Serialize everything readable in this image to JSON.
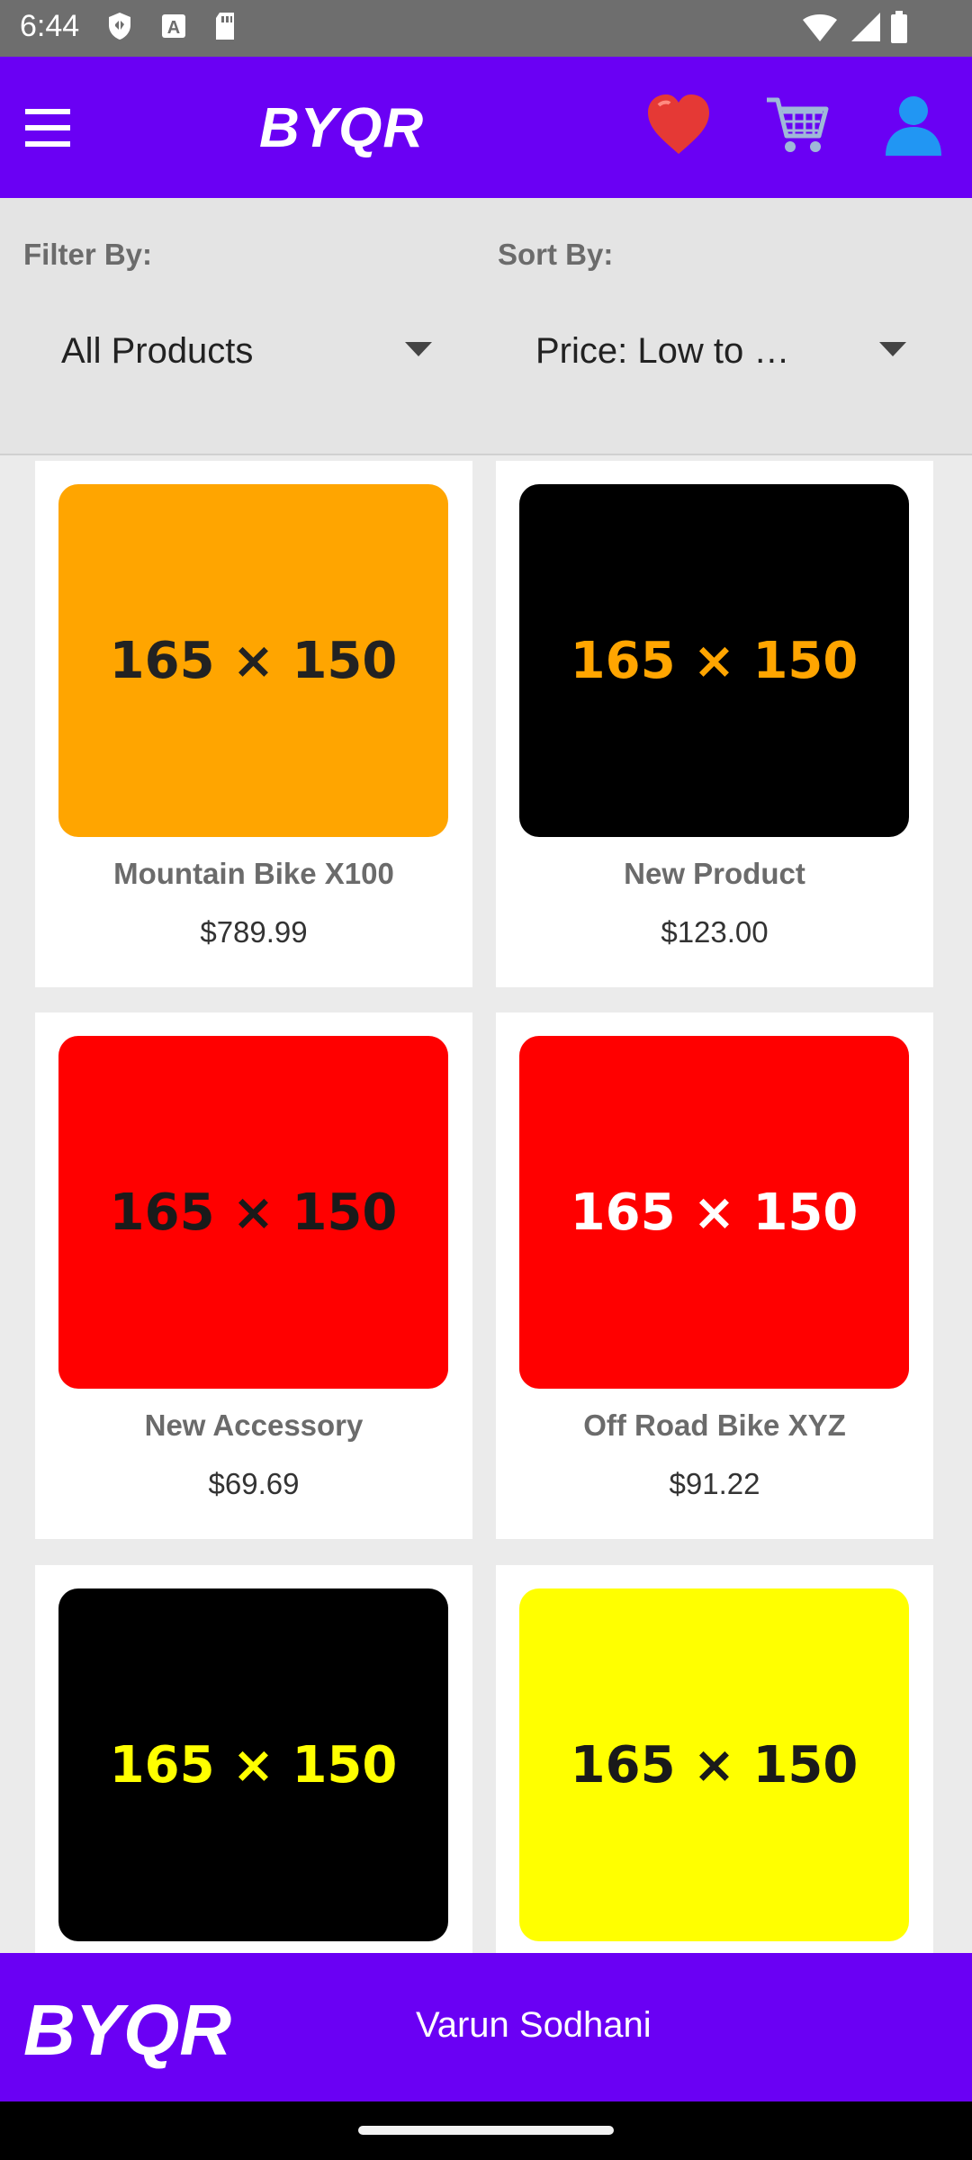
{
  "status": {
    "time": "6:44"
  },
  "appbar": {
    "brand": "BYQR"
  },
  "controls": {
    "filter_label": "Filter By:",
    "filter_value": "All Products",
    "sort_label": "Sort By:",
    "sort_value": "Price: Low to …"
  },
  "products": [
    {
      "name": "Mountain Bike X100",
      "price": "$789.99",
      "thumb_text": "165 × 150",
      "bg": "#ffa500",
      "fg": "#222222"
    },
    {
      "name": "New Product",
      "price": "$123.00",
      "thumb_text": "165 × 150",
      "bg": "#000000",
      "fg": "#ffa500"
    },
    {
      "name": "New Accessory",
      "price": "$69.69",
      "thumb_text": "165 × 150",
      "bg": "#ff0000",
      "fg": "#1a1a1a"
    },
    {
      "name": "Off Road Bike XYZ",
      "price": "$91.22",
      "thumb_text": "165 × 150",
      "bg": "#ff0000",
      "fg": "#ffffff"
    },
    {
      "name": "",
      "price": "",
      "thumb_text": "165 × 150",
      "bg": "#000000",
      "fg": "#ffff00"
    },
    {
      "name": "",
      "price": "",
      "thumb_text": "165 × 150",
      "bg": "#ffff00",
      "fg": "#1a1a1a"
    }
  ],
  "footer": {
    "brand": "BYQR",
    "user": "Varun Sodhani"
  },
  "colors": {
    "primary": "#6a00f4"
  },
  "icons": [
    "menu-icon",
    "heart-icon",
    "cart-icon",
    "account-icon"
  ]
}
